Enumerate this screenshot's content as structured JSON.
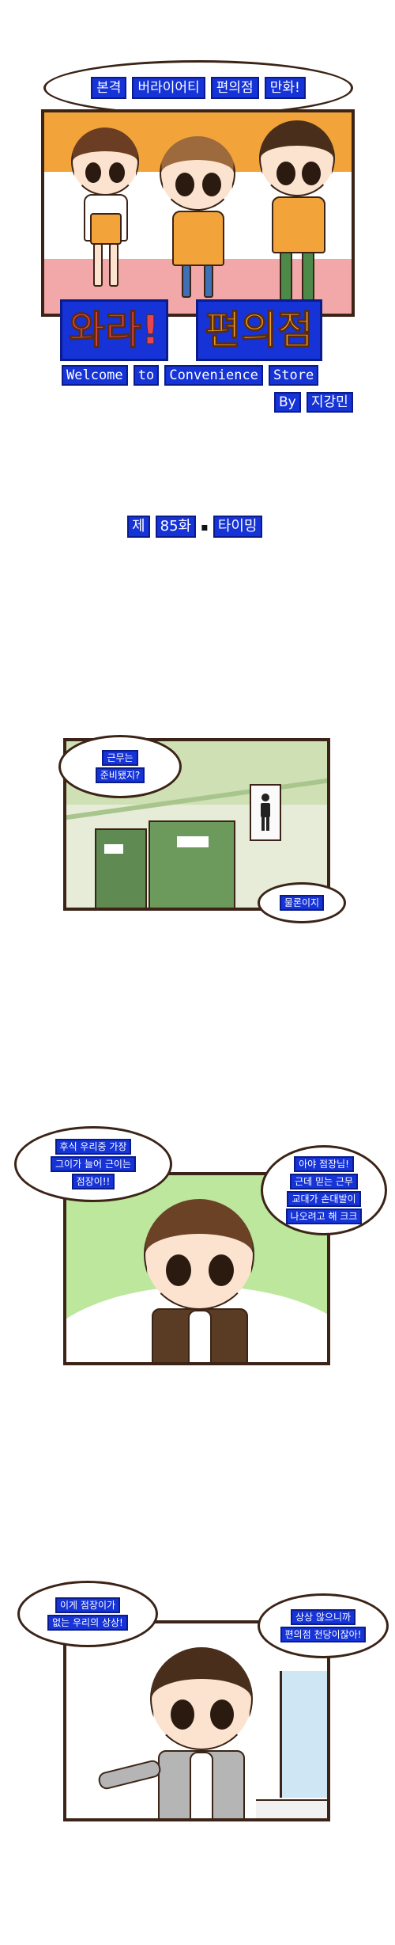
{
  "cover": {
    "tagline_words": [
      "본격",
      "버라이어티",
      "편의점",
      "만화!"
    ],
    "title_part1": "와라!",
    "title_part2": "편의점",
    "subtitle_words": [
      "Welcome",
      "to",
      "Convenience",
      "Store"
    ],
    "byline_by": "By",
    "byline_author": "지강민"
  },
  "episode": {
    "number": "제",
    "count": "85화",
    "separator": "▪",
    "title": "타이밍"
  },
  "panel1": {
    "bubble1_line1": "근무는",
    "bubble1_line2": "준비됐지?",
    "bubble2": "물론이지"
  },
  "panel2": {
    "left_line1": "후식 우리중 가장",
    "left_line2": "그이가 늘어 근이는",
    "left_line3": "점장이!!",
    "right_line1": "아야 점장님!",
    "right_line2": "근데 믿는 근무",
    "right_line3": "교대가 손대발이",
    "right_line4": "나오려고 해 크크"
  },
  "panel3": {
    "left_line1": "이게 점장이가",
    "left_line2": "없는 우리의 상상!",
    "right_line1": "상상 않으니까",
    "right_line2": "편의점 천당이잖아!"
  },
  "colors": {
    "frame": "#3b2417",
    "ocr_box": "#1533d6",
    "cover_orange": "#f2a43a",
    "cover_pink": "#f2a8a8",
    "panel1_bg": "#e6ecd8",
    "panel2_bg": "#bde79c"
  }
}
